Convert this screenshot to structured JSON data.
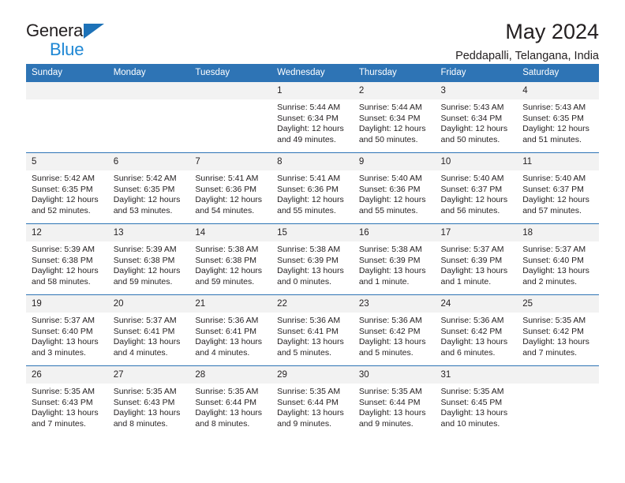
{
  "brand": {
    "name_top": "General",
    "name_bottom": "Blue",
    "accent_color": "#1e87d4",
    "triangle_color": "#1d72b8"
  },
  "header": {
    "title": "May 2024",
    "subtitle": "Peddapalli, Telangana, India"
  },
  "theme": {
    "header_bg": "#2e74b5",
    "header_text": "#ffffff",
    "daynum_bg": "#f2f2f2",
    "body_text": "#231f20"
  },
  "calendar": {
    "weekdays": [
      "Sunday",
      "Monday",
      "Tuesday",
      "Wednesday",
      "Thursday",
      "Friday",
      "Saturday"
    ],
    "weeks": [
      [
        {
          "day": "",
          "blank": true,
          "sunrise": "",
          "sunset": "",
          "daylight1": "",
          "daylight2": ""
        },
        {
          "day": "",
          "blank": true,
          "sunrise": "",
          "sunset": "",
          "daylight1": "",
          "daylight2": ""
        },
        {
          "day": "",
          "blank": true,
          "sunrise": "",
          "sunset": "",
          "daylight1": "",
          "daylight2": ""
        },
        {
          "day": "1",
          "sunrise": "Sunrise: 5:44 AM",
          "sunset": "Sunset: 6:34 PM",
          "daylight1": "Daylight: 12 hours",
          "daylight2": "and 49 minutes."
        },
        {
          "day": "2",
          "sunrise": "Sunrise: 5:44 AM",
          "sunset": "Sunset: 6:34 PM",
          "daylight1": "Daylight: 12 hours",
          "daylight2": "and 50 minutes."
        },
        {
          "day": "3",
          "sunrise": "Sunrise: 5:43 AM",
          "sunset": "Sunset: 6:34 PM",
          "daylight1": "Daylight: 12 hours",
          "daylight2": "and 50 minutes."
        },
        {
          "day": "4",
          "sunrise": "Sunrise: 5:43 AM",
          "sunset": "Sunset: 6:35 PM",
          "daylight1": "Daylight: 12 hours",
          "daylight2": "and 51 minutes."
        }
      ],
      [
        {
          "day": "5",
          "sunrise": "Sunrise: 5:42 AM",
          "sunset": "Sunset: 6:35 PM",
          "daylight1": "Daylight: 12 hours",
          "daylight2": "and 52 minutes."
        },
        {
          "day": "6",
          "sunrise": "Sunrise: 5:42 AM",
          "sunset": "Sunset: 6:35 PM",
          "daylight1": "Daylight: 12 hours",
          "daylight2": "and 53 minutes."
        },
        {
          "day": "7",
          "sunrise": "Sunrise: 5:41 AM",
          "sunset": "Sunset: 6:36 PM",
          "daylight1": "Daylight: 12 hours",
          "daylight2": "and 54 minutes."
        },
        {
          "day": "8",
          "sunrise": "Sunrise: 5:41 AM",
          "sunset": "Sunset: 6:36 PM",
          "daylight1": "Daylight: 12 hours",
          "daylight2": "and 55 minutes."
        },
        {
          "day": "9",
          "sunrise": "Sunrise: 5:40 AM",
          "sunset": "Sunset: 6:36 PM",
          "daylight1": "Daylight: 12 hours",
          "daylight2": "and 55 minutes."
        },
        {
          "day": "10",
          "sunrise": "Sunrise: 5:40 AM",
          "sunset": "Sunset: 6:37 PM",
          "daylight1": "Daylight: 12 hours",
          "daylight2": "and 56 minutes."
        },
        {
          "day": "11",
          "sunrise": "Sunrise: 5:40 AM",
          "sunset": "Sunset: 6:37 PM",
          "daylight1": "Daylight: 12 hours",
          "daylight2": "and 57 minutes."
        }
      ],
      [
        {
          "day": "12",
          "sunrise": "Sunrise: 5:39 AM",
          "sunset": "Sunset: 6:38 PM",
          "daylight1": "Daylight: 12 hours",
          "daylight2": "and 58 minutes."
        },
        {
          "day": "13",
          "sunrise": "Sunrise: 5:39 AM",
          "sunset": "Sunset: 6:38 PM",
          "daylight1": "Daylight: 12 hours",
          "daylight2": "and 59 minutes."
        },
        {
          "day": "14",
          "sunrise": "Sunrise: 5:38 AM",
          "sunset": "Sunset: 6:38 PM",
          "daylight1": "Daylight: 12 hours",
          "daylight2": "and 59 minutes."
        },
        {
          "day": "15",
          "sunrise": "Sunrise: 5:38 AM",
          "sunset": "Sunset: 6:39 PM",
          "daylight1": "Daylight: 13 hours",
          "daylight2": "and 0 minutes."
        },
        {
          "day": "16",
          "sunrise": "Sunrise: 5:38 AM",
          "sunset": "Sunset: 6:39 PM",
          "daylight1": "Daylight: 13 hours",
          "daylight2": "and 1 minute."
        },
        {
          "day": "17",
          "sunrise": "Sunrise: 5:37 AM",
          "sunset": "Sunset: 6:39 PM",
          "daylight1": "Daylight: 13 hours",
          "daylight2": "and 1 minute."
        },
        {
          "day": "18",
          "sunrise": "Sunrise: 5:37 AM",
          "sunset": "Sunset: 6:40 PM",
          "daylight1": "Daylight: 13 hours",
          "daylight2": "and 2 minutes."
        }
      ],
      [
        {
          "day": "19",
          "sunrise": "Sunrise: 5:37 AM",
          "sunset": "Sunset: 6:40 PM",
          "daylight1": "Daylight: 13 hours",
          "daylight2": "and 3 minutes."
        },
        {
          "day": "20",
          "sunrise": "Sunrise: 5:37 AM",
          "sunset": "Sunset: 6:41 PM",
          "daylight1": "Daylight: 13 hours",
          "daylight2": "and 4 minutes."
        },
        {
          "day": "21",
          "sunrise": "Sunrise: 5:36 AM",
          "sunset": "Sunset: 6:41 PM",
          "daylight1": "Daylight: 13 hours",
          "daylight2": "and 4 minutes."
        },
        {
          "day": "22",
          "sunrise": "Sunrise: 5:36 AM",
          "sunset": "Sunset: 6:41 PM",
          "daylight1": "Daylight: 13 hours",
          "daylight2": "and 5 minutes."
        },
        {
          "day": "23",
          "sunrise": "Sunrise: 5:36 AM",
          "sunset": "Sunset: 6:42 PM",
          "daylight1": "Daylight: 13 hours",
          "daylight2": "and 5 minutes."
        },
        {
          "day": "24",
          "sunrise": "Sunrise: 5:36 AM",
          "sunset": "Sunset: 6:42 PM",
          "daylight1": "Daylight: 13 hours",
          "daylight2": "and 6 minutes."
        },
        {
          "day": "25",
          "sunrise": "Sunrise: 5:35 AM",
          "sunset": "Sunset: 6:42 PM",
          "daylight1": "Daylight: 13 hours",
          "daylight2": "and 7 minutes."
        }
      ],
      [
        {
          "day": "26",
          "sunrise": "Sunrise: 5:35 AM",
          "sunset": "Sunset: 6:43 PM",
          "daylight1": "Daylight: 13 hours",
          "daylight2": "and 7 minutes."
        },
        {
          "day": "27",
          "sunrise": "Sunrise: 5:35 AM",
          "sunset": "Sunset: 6:43 PM",
          "daylight1": "Daylight: 13 hours",
          "daylight2": "and 8 minutes."
        },
        {
          "day": "28",
          "sunrise": "Sunrise: 5:35 AM",
          "sunset": "Sunset: 6:44 PM",
          "daylight1": "Daylight: 13 hours",
          "daylight2": "and 8 minutes."
        },
        {
          "day": "29",
          "sunrise": "Sunrise: 5:35 AM",
          "sunset": "Sunset: 6:44 PM",
          "daylight1": "Daylight: 13 hours",
          "daylight2": "and 9 minutes."
        },
        {
          "day": "30",
          "sunrise": "Sunrise: 5:35 AM",
          "sunset": "Sunset: 6:44 PM",
          "daylight1": "Daylight: 13 hours",
          "daylight2": "and 9 minutes."
        },
        {
          "day": "31",
          "sunrise": "Sunrise: 5:35 AM",
          "sunset": "Sunset: 6:45 PM",
          "daylight1": "Daylight: 13 hours",
          "daylight2": "and 10 minutes."
        },
        {
          "day": "",
          "blank": true,
          "sunrise": "",
          "sunset": "",
          "daylight1": "",
          "daylight2": ""
        }
      ]
    ]
  }
}
